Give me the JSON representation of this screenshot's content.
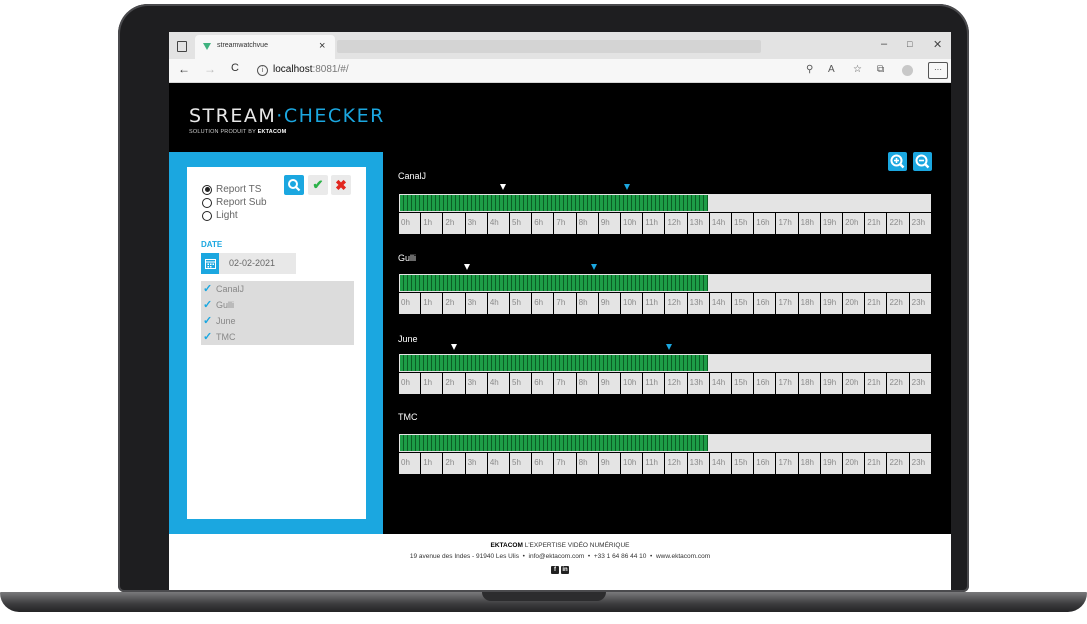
{
  "browser": {
    "tab_title": "streamwatchvue",
    "tab_close": "×",
    "back": "←",
    "forward": "→",
    "reload": "C",
    "url_host": "localhost",
    "url_rest": ":8081/#/",
    "window_controls": [
      "–",
      "□",
      "✕"
    ],
    "toolbar_icons": [
      "zoom-icon",
      "read-aloud-icon",
      "favorites-icon",
      "collections-icon",
      "profile-icon",
      "more-icon"
    ],
    "more_label": "···"
  },
  "app": {
    "logo_main": "STREAM",
    "logo_dot": "·",
    "logo_accent": "CHECKER",
    "logo_sub": "SOLUTION PRODUIT BY",
    "logo_sub_brand": "EKTACOM",
    "accent_color": "#1ba7e0"
  },
  "sidebar": {
    "report_options": [
      {
        "label": "Report TS",
        "selected": true
      },
      {
        "label": "Report Sub",
        "selected": false
      },
      {
        "label": "Light",
        "selected": false
      }
    ],
    "date_label": "DATE",
    "date_value": "02-02-2021",
    "check_label": "✔",
    "cancel_label": "✖",
    "channels": [
      {
        "label": "CanalJ",
        "checked": true
      },
      {
        "label": "Gulli",
        "checked": true
      },
      {
        "label": "June",
        "checked": true
      },
      {
        "label": "TMC",
        "checked": true
      }
    ]
  },
  "timelines": {
    "hours": [
      "0h",
      "1h",
      "2h",
      "3h",
      "4h",
      "5h",
      "6h",
      "7h",
      "8h",
      "9h",
      "10h",
      "11h",
      "12h",
      "13h",
      "14h",
      "15h",
      "16h",
      "17h",
      "18h",
      "19h",
      "20h",
      "21h",
      "22h",
      "23h"
    ],
    "channels": [
      {
        "name": "CanalJ",
        "recorded_until_hour": 14.0,
        "markers": [
          {
            "hour": 4.7,
            "color": "white"
          },
          {
            "hour": 10.3,
            "color": "blue"
          }
        ]
      },
      {
        "name": "Gulli",
        "recorded_until_hour": 14.0,
        "markers": [
          {
            "hour": 3.1,
            "color": "white"
          },
          {
            "hour": 8.8,
            "color": "blue"
          }
        ]
      },
      {
        "name": "June",
        "recorded_until_hour": 14.0,
        "markers": [
          {
            "hour": 2.5,
            "color": "white"
          },
          {
            "hour": 12.2,
            "color": "blue"
          }
        ]
      },
      {
        "name": "TMC",
        "recorded_until_hour": 14.0,
        "markers": []
      }
    ]
  },
  "footer": {
    "brand": "EKTACOM",
    "tagline": "L'EXPERTISE VIDÉO NUMÉRIQUE",
    "address": "19 avenue des Indes - 91940 Les Ulis",
    "email": "info@ektacom.com",
    "phone": "+33 1 64 86 44 10",
    "website": "www.ektacom.com",
    "separator": "•",
    "social": [
      "f",
      "in"
    ]
  }
}
